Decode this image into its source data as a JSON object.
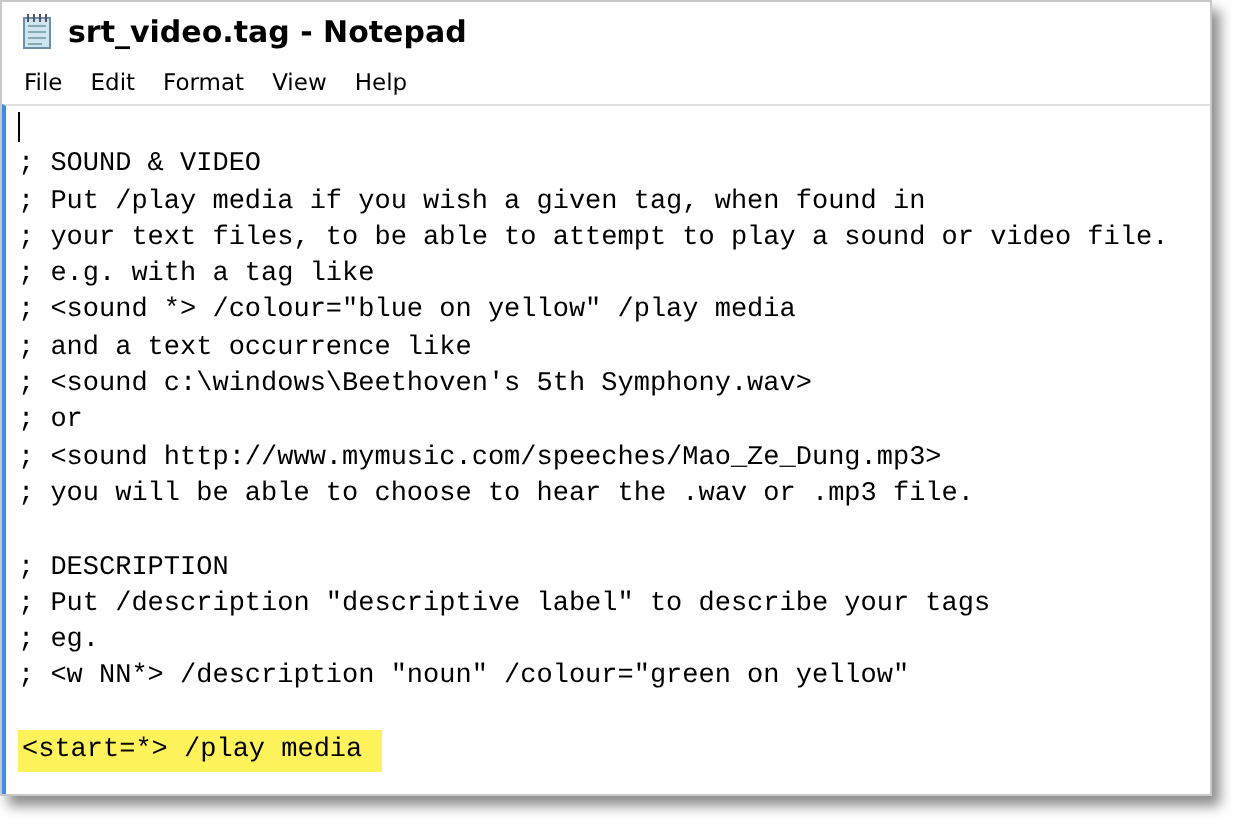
{
  "window": {
    "title": "srt_video.tag - Notepad"
  },
  "menu": [
    "File",
    "Edit",
    "Format",
    "View",
    "Help"
  ],
  "editor": {
    "lines": [
      {
        "kind": "cursor"
      },
      {
        "kind": "text",
        "text": "; SOUND & VIDEO",
        "highlighted": false
      },
      {
        "kind": "text",
        "text": "; Put /play media if you wish a given tag, when found in",
        "highlighted": false
      },
      {
        "kind": "text",
        "text": "; your text files, to be able to attempt to play a sound or video file.",
        "highlighted": false
      },
      {
        "kind": "text",
        "text": "; e.g. with a tag like",
        "highlighted": false
      },
      {
        "kind": "text",
        "text": "; <sound *> /colour=\"blue on yellow\" /play media",
        "highlighted": false
      },
      {
        "kind": "text",
        "text": "; and a text occurrence like",
        "highlighted": false
      },
      {
        "kind": "text",
        "text": "; <sound c:\\windows\\Beethoven's 5th Symphony.wav>",
        "highlighted": false
      },
      {
        "kind": "text",
        "text": "; or",
        "highlighted": false
      },
      {
        "kind": "text",
        "text": "; <sound http://www.mymusic.com/speeches/Mao_Ze_Dung.mp3>",
        "highlighted": false
      },
      {
        "kind": "text",
        "text": "; you will be able to choose to hear the .wav or .mp3 file.",
        "highlighted": false
      },
      {
        "kind": "blank"
      },
      {
        "kind": "text",
        "text": "; DESCRIPTION",
        "highlighted": false
      },
      {
        "kind": "text",
        "text": "; Put /description \"descriptive label\" to describe your tags",
        "highlighted": false
      },
      {
        "kind": "text",
        "text": "; eg.",
        "highlighted": false
      },
      {
        "kind": "text",
        "text": "; <w NN*> /description \"noun\" /colour=\"green on yellow\"",
        "highlighted": false
      },
      {
        "kind": "blank"
      },
      {
        "kind": "text",
        "text": "<start=*> /play media ",
        "highlighted": true
      }
    ]
  }
}
